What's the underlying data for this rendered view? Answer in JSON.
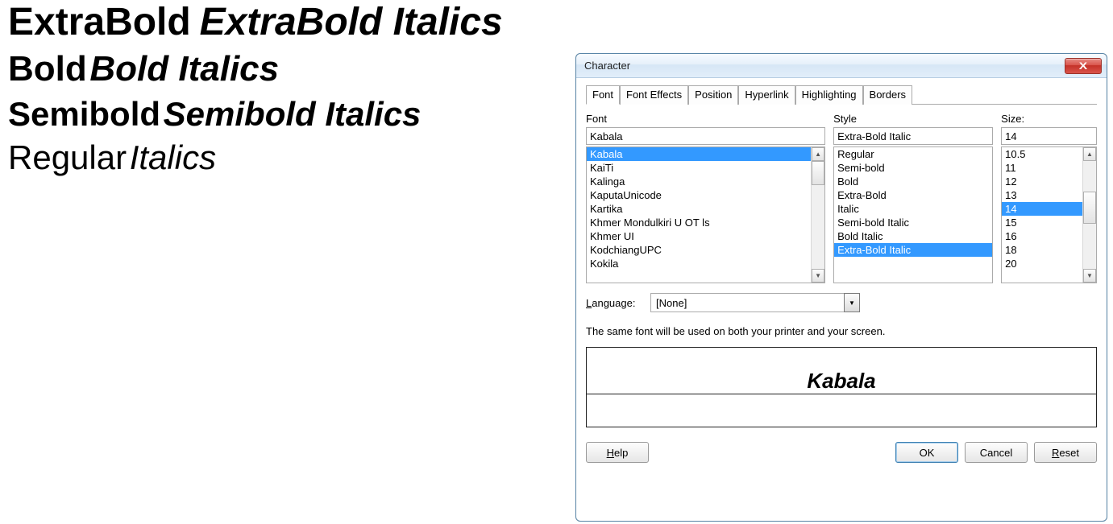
{
  "background": {
    "row1a": "ExtraBold",
    "row1b": "ExtraBold Italics",
    "row2a": "Bold",
    "row2b": "Bold Italics",
    "row3a": "Semibold",
    "row3b": "Semibold Italics",
    "row4a": "Regular",
    "row4b": "Italics"
  },
  "dialog": {
    "title": "Character",
    "tabs": {
      "font": "Font",
      "font_effects": "Font Effects",
      "position": "Position",
      "hyperlink": "Hyperlink",
      "highlighting": "Highlighting",
      "borders": "Borders"
    },
    "labels": {
      "font": "Font",
      "style": "Style",
      "size": "Size:"
    },
    "font_value": "Kabala",
    "style_value": "Extra-Bold Italic",
    "size_value": "14",
    "fonts": [
      "Kabala",
      "KaiTi",
      "Kalinga",
      "KaputaUnicode",
      "Kartika",
      "Khmer Mondulkiri U OT ls",
      "Khmer UI",
      "KodchiangUPC",
      "Kokila"
    ],
    "styles": [
      "Regular",
      "Semi-bold",
      "Bold",
      "Extra-Bold",
      "Italic",
      "Semi-bold Italic",
      "Bold Italic",
      "Extra-Bold Italic"
    ],
    "sizes": [
      "10.5",
      "11",
      "12",
      "13",
      "14",
      "15",
      "16",
      "18",
      "20"
    ],
    "font_selected": "Kabala",
    "style_selected": "Extra-Bold Italic",
    "size_selected": "14",
    "language_label": "Language:",
    "language_value": "[None]",
    "note_text": "The same font will be used on both your printer and your screen.",
    "preview_text": "Kabala",
    "buttons": {
      "help": "Help",
      "ok": "OK",
      "cancel": "Cancel",
      "reset": "Reset"
    }
  }
}
